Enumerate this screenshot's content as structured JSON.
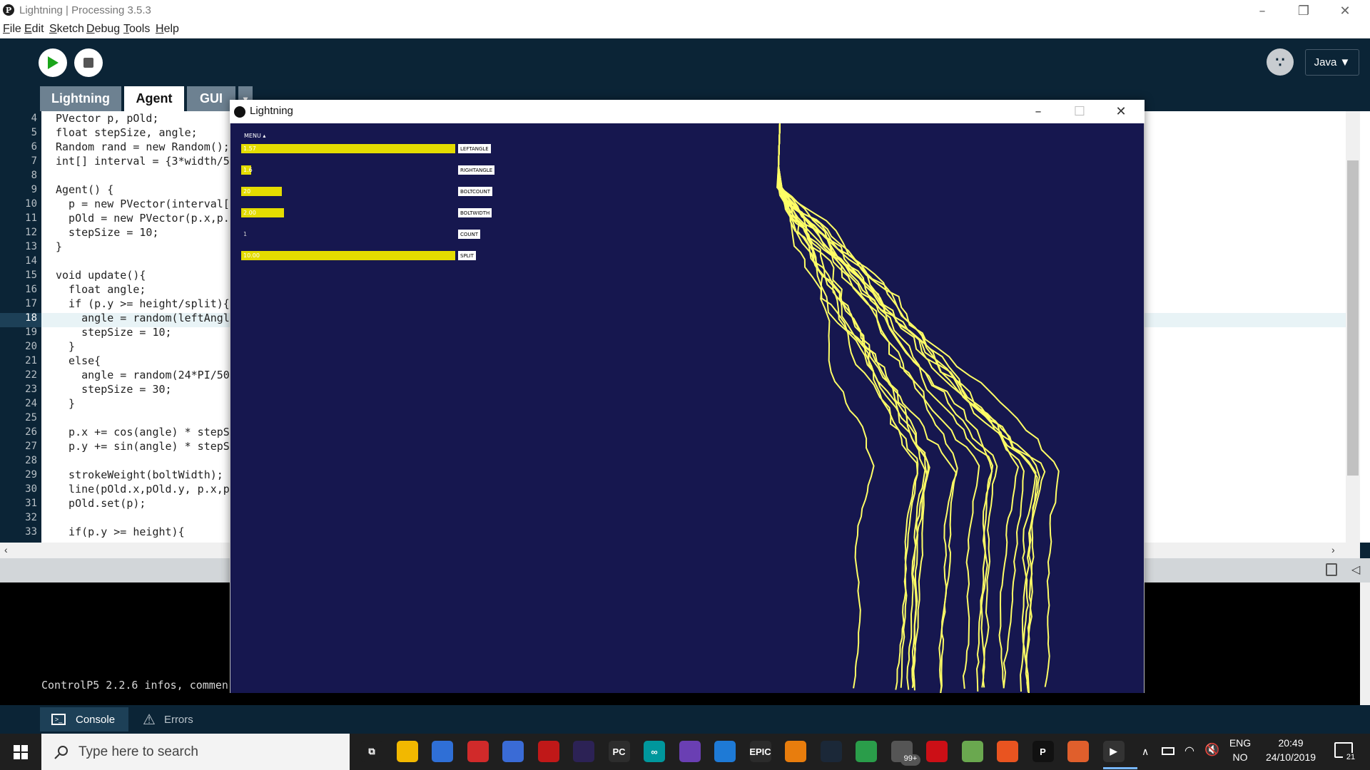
{
  "ide": {
    "window_title": "Lightning | Processing 3.5.3",
    "menu": [
      "File",
      "Edit",
      "Sketch",
      "Debug",
      "Tools",
      "Help"
    ],
    "mode": "Java ▼",
    "tabs": [
      "Lightning",
      "Agent",
      "GUI"
    ],
    "active_tab": "Agent",
    "highlighted_line": 18,
    "code_lines": [
      {
        "n": "4",
        "t": "PVector p, pOld;"
      },
      {
        "n": "5",
        "t": "float stepSize, angle;"
      },
      {
        "n": "6",
        "t": "Random rand = new Random();"
      },
      {
        "n": "7",
        "t": "int[] interval = {3*width/5"
      },
      {
        "n": "8",
        "t": ""
      },
      {
        "n": "9",
        "t": "Agent() {"
      },
      {
        "n": "10",
        "t": "  p = new PVector(interval["
      },
      {
        "n": "11",
        "t": "  pOld = new PVector(p.x,p."
      },
      {
        "n": "12",
        "t": "  stepSize = 10;"
      },
      {
        "n": "13",
        "t": "}"
      },
      {
        "n": "14",
        "t": ""
      },
      {
        "n": "15",
        "t": "void update(){"
      },
      {
        "n": "16",
        "t": "  float angle;"
      },
      {
        "n": "17",
        "t": "  if (p.y >= height/split){"
      },
      {
        "n": "18",
        "t": "    angle = random(leftAngl"
      },
      {
        "n": "19",
        "t": "    stepSize = 10;"
      },
      {
        "n": "20",
        "t": "  }"
      },
      {
        "n": "21",
        "t": "  else{"
      },
      {
        "n": "22",
        "t": "    angle = random(24*PI/50"
      },
      {
        "n": "23",
        "t": "    stepSize = 30;"
      },
      {
        "n": "24",
        "t": "  }"
      },
      {
        "n": "25",
        "t": ""
      },
      {
        "n": "26",
        "t": "  p.x += cos(angle) * stepS"
      },
      {
        "n": "27",
        "t": "  p.y += sin(angle) * stepS"
      },
      {
        "n": "28",
        "t": ""
      },
      {
        "n": "29",
        "t": "  strokeWeight(boltWidth);"
      },
      {
        "n": "30",
        "t": "  line(pOld.x,pOld.y, p.x,p"
      },
      {
        "n": "31",
        "t": "  pOld.set(p);"
      },
      {
        "n": "32",
        "t": ""
      },
      {
        "n": "33",
        "t": "  if(p.y >= height){"
      }
    ],
    "console_text": "ControlP5 2.2.6 infos, commen",
    "console_tabs": [
      "Console",
      "Errors"
    ]
  },
  "sketch": {
    "title": "Lightning",
    "menu_label": "MENU ▴",
    "sliders": [
      {
        "label": "LEFTANGLE",
        "value": "1.57",
        "fill": 1.0
      },
      {
        "label": "RIGHTANGLE",
        "value": "1.6",
        "fill": 0.045
      },
      {
        "label": "BOLTCOUNT",
        "value": "20",
        "fill": 0.19
      },
      {
        "label": "BOLTWIDTH",
        "value": "2.00",
        "fill": 0.2
      },
      {
        "label": "COUNT",
        "value": "1",
        "fill": 0.0
      },
      {
        "label": "SPLIT",
        "value": "10.00",
        "fill": 1.0
      }
    ],
    "bolt_color": "#ffff66",
    "bg_color": "#16174f"
  },
  "taskbar": {
    "search_placeholder": "Type here to search",
    "badge": "99+",
    "lang_top": "ENG",
    "lang_bottom": "NO",
    "time": "20:49",
    "date": "24/10/2019",
    "notifications": "21"
  }
}
